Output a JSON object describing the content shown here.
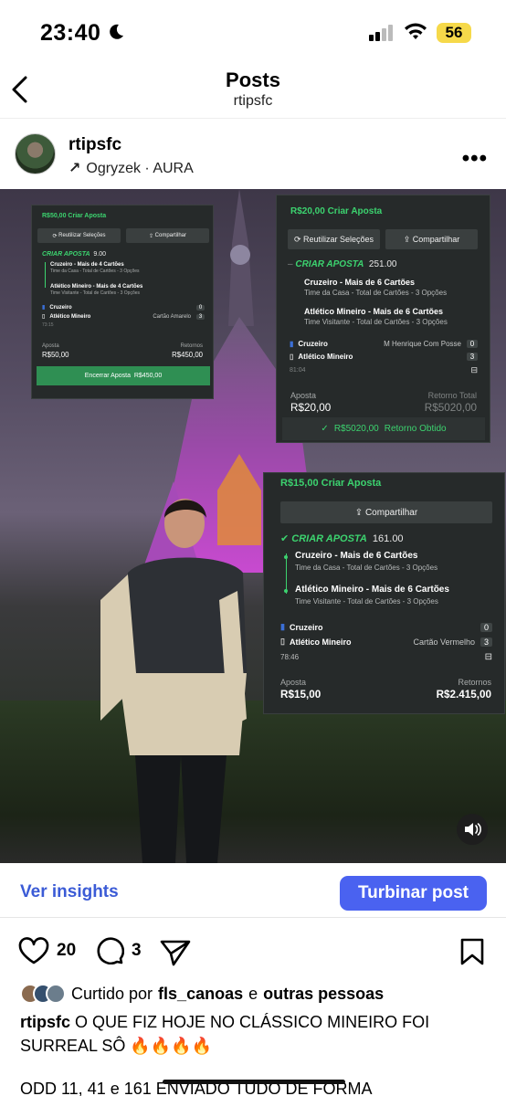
{
  "status": {
    "time": "23:40",
    "battery": "56"
  },
  "header": {
    "title": "Posts",
    "subtitle": "rtipsfc"
  },
  "post": {
    "username": "rtipsfc",
    "music": "Ogryzek · AURA"
  },
  "bet1": {
    "title": "R$50,00 Criar Aposta",
    "btn_reuse": "Reutilizar Seleções",
    "btn_share": "Compartilhar",
    "cria": "CRIAR APOSTA",
    "odd": "9.00",
    "sel1_title": "Cruzeiro - Mais de 4 Cartões",
    "sel1_desc": "Time da Casa - Total de Cartões - 3 Opções",
    "sel2_title": "Atlético Mineiro - Mais de 4 Cartões",
    "sel2_desc": "Time Visitante - Total de Cartões - 3 Opções",
    "team1": "Cruzeiro",
    "team1_score": "0",
    "team2": "Atlético Mineiro",
    "team2_event": "Cartão Amarelo",
    "team2_score": "3",
    "clock": "73:15",
    "aposta_label": "Aposta",
    "aposta_value": "R$50,00",
    "ret_label": "Retornos",
    "ret_value": "R$450,00",
    "close_label": "Encerrar Aposta",
    "close_value": "R$450,00"
  },
  "bet2": {
    "title": "R$20,00 Criar Aposta",
    "btn_reuse": "Reutilizar Seleções",
    "btn_share": "Compartilhar",
    "cria": "CRIAR APOSTA",
    "odd": "251.00",
    "sel1_title": "Cruzeiro - Mais de 6 Cartões",
    "sel1_desc": "Time da Casa - Total de Cartões - 3 Opções",
    "sel2_title": "Atlético Mineiro - Mais de 6 Cartões",
    "sel2_desc": "Time Visitante - Total de Cartões - 3 Opções",
    "team1": "Cruzeiro",
    "team1_event": "M Henrique Com Posse",
    "team1_score": "0",
    "team2": "Atlético Mineiro",
    "team2_score": "3",
    "clock": "81:04",
    "aposta_label": "Aposta",
    "aposta_value": "R$20,00",
    "ret_label": "Retorno Total",
    "ret_value": "R$5020,00",
    "obtained_value": "R$5020,00",
    "obtained_label": "Retorno Obtido"
  },
  "bet3": {
    "title": "R$15,00  Criar Aposta",
    "btn_share": "Compartilhar",
    "cria": "CRIAR APOSTA",
    "odd": "161.00",
    "sel1_title": "Cruzeiro - Mais de 6 Cartões",
    "sel1_desc": "Time da Casa - Total de Cartões - 3 Opções",
    "sel2_title": "Atlético Mineiro - Mais de 6 Cartões",
    "sel2_desc": "Time Visitante - Total de Cartões - 3 Opções",
    "team1": "Cruzeiro",
    "team1_score": "0",
    "team2": "Atlético Mineiro",
    "team2_event": "Cartão Vermelho",
    "team2_score": "3",
    "clock": "78:46",
    "aposta_label": "Aposta",
    "aposta_value": "R$15,00",
    "ret_label": "Retornos",
    "ret_value": "R$2.415,00"
  },
  "insights": {
    "link": "Ver insights",
    "boost": "Turbinar post"
  },
  "actions": {
    "likes": "20",
    "comments": "3"
  },
  "liked_by": {
    "prefix": "Curtido por",
    "user": "fls_canoas",
    "mid": "e",
    "others": "outras pessoas"
  },
  "caption": {
    "user": "rtipsfc",
    "text": "O QUE FIZ HOJE NO CLÁSSICO MINEIRO FOI SURREAL SÔ 🔥🔥🔥🔥",
    "line2": "ODD 11, 41 e 161 ENVIADO TUDO DE FORMA"
  },
  "colors": {
    "accent": "#4a62f0",
    "link": "#3b5bd6",
    "bet_green": "#3cd36f",
    "card_bg": "#262a2a"
  }
}
